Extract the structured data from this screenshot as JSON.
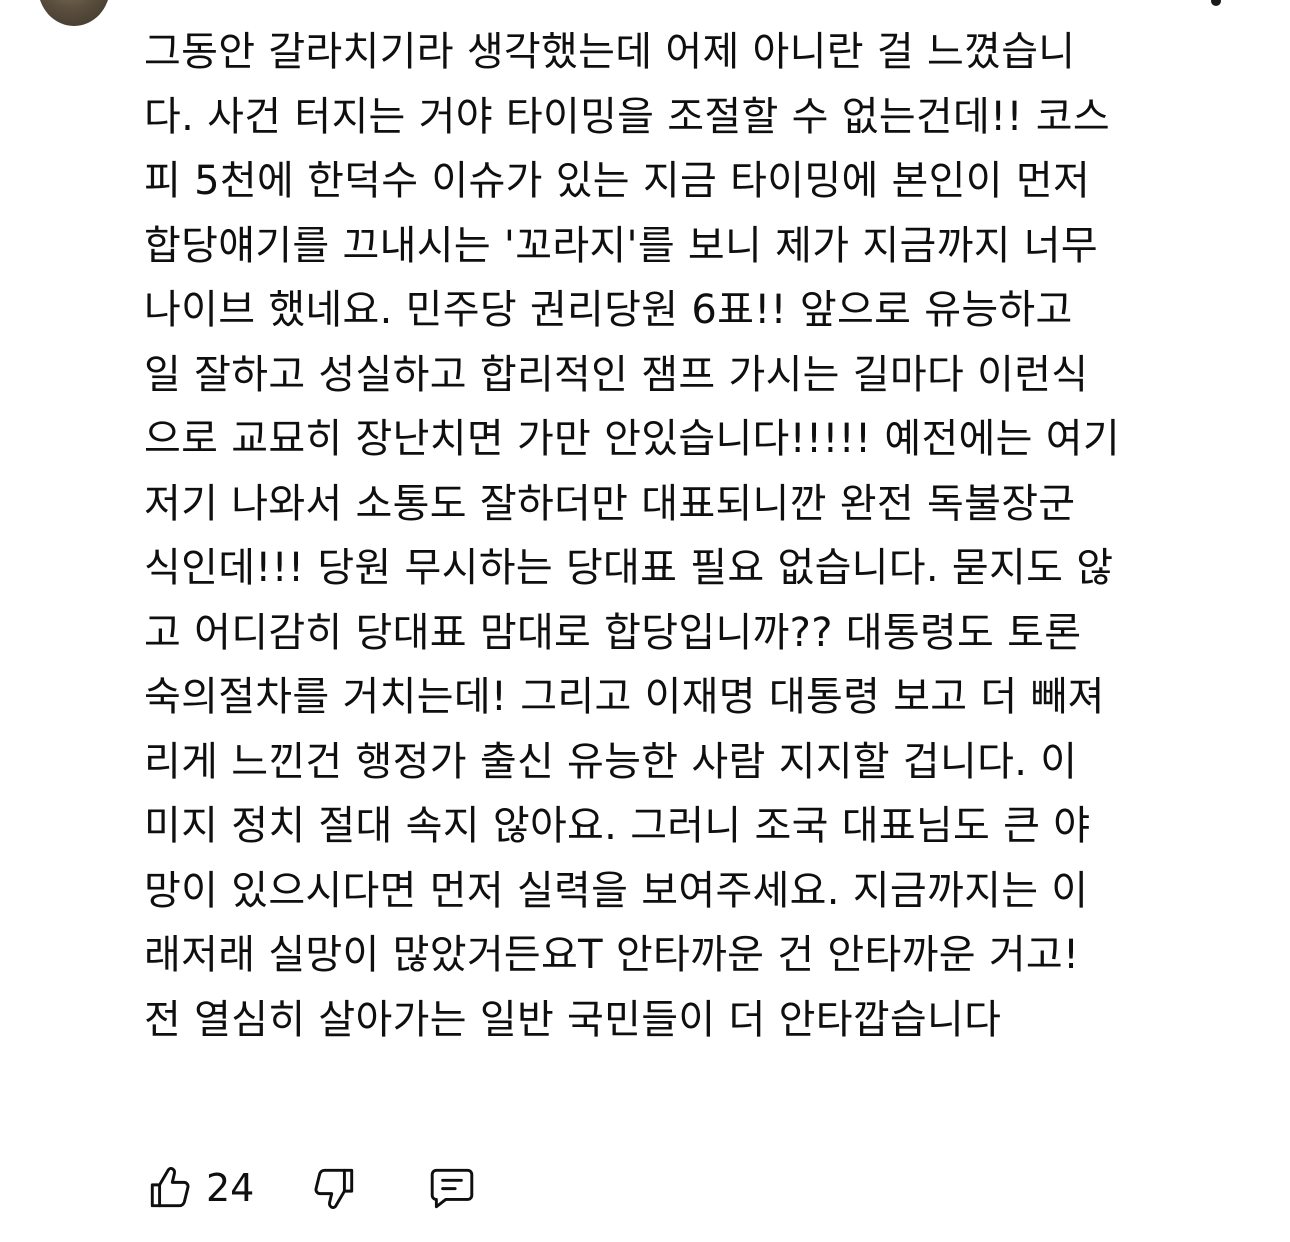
{
  "comment": {
    "lines": [
      "그동안 갈라치기라 생각했는데 어제 아니란 걸 느꼈습니",
      "다. 사건 터지는 거야 타이밍을 조절할 수 없는건데!! 코스",
      "피 5천에 한덕수 이슈가 있는 지금 타이밍에 본인이 먼저",
      "합당얘기를 끄내시는 '꼬라지'를 보니 제가 지금까지 너무",
      "나이브 했네요. 민주당 권리당원 6표!! 앞으로 유능하고",
      "일 잘하고 성실하고 합리적인 잼프 가시는 길마다 이런식",
      "으로 교묘히 장난치면 가만 안있습니다!!!!! 예전에는 여기",
      "저기 나와서 소통도 잘하더만 대표되니깐 완전 독불장군",
      "식인데!!! 당원 무시하는 당대표 필요 없습니다. 묻지도 않",
      "고 어디감히 당대표 맘대로 합당입니까?? 대통령도 토론",
      "숙의절차를 거치는데! 그리고 이재명 대통령 보고 더 빼져",
      "리게 느낀건 행정가 출신 유능한 사람 지지할 겁니다. 이",
      "미지 정치 절대 속지 않아요. 그러니 조국 대표님도 큰 야",
      "망이 있으시다면 먼저 실력을 보여주세요. 지금까지는 이",
      "래저래 실망이 많았거든요T 안타까운 건 안타까운 거고!",
      "전 열심히 살아가는 일반 국민들이 더 안타깝습니다"
    ]
  },
  "actions": {
    "like_count": "24",
    "like_icon": "thumbs-up-icon",
    "dislike_icon": "thumbs-down-icon",
    "reply_icon": "comment-icon"
  },
  "colors": {
    "text": "#0f0f0f",
    "background": "#ffffff"
  }
}
